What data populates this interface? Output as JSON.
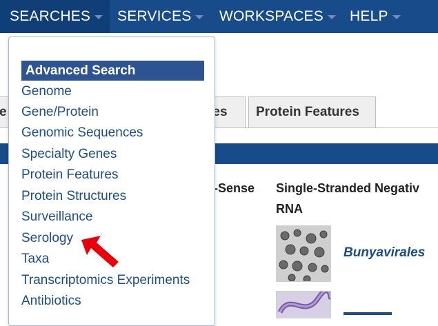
{
  "nav": {
    "items": [
      {
        "label": "SEARCHES"
      },
      {
        "label": "SERVICES"
      },
      {
        "label": "WORKSPACES"
      },
      {
        "label": "HELP"
      }
    ]
  },
  "tabs": {
    "partial_left": "e",
    "partial_middle": "res",
    "protein_features": "Protein Features"
  },
  "columns": {
    "partial_header": "-Sense",
    "ss_negative_header_line1": "Single-Stranded Negativ",
    "ss_negative_header_line2": "RNA"
  },
  "virus": {
    "bunyavirales": "Bunyavirales"
  },
  "dropdown": {
    "header": "Advanced Search",
    "items": [
      "Genome",
      "Gene/Protein",
      "Genomic Sequences",
      "Specialty Genes",
      "Protein Features",
      "Protein Structures",
      "Surveillance",
      "Serology",
      "Taxa",
      "Transcriptomics Experiments",
      "Antibiotics"
    ]
  },
  "colors": {
    "nav_bg": "#174b89",
    "link": "#1b4d8a",
    "arrow": "#e8000b"
  }
}
